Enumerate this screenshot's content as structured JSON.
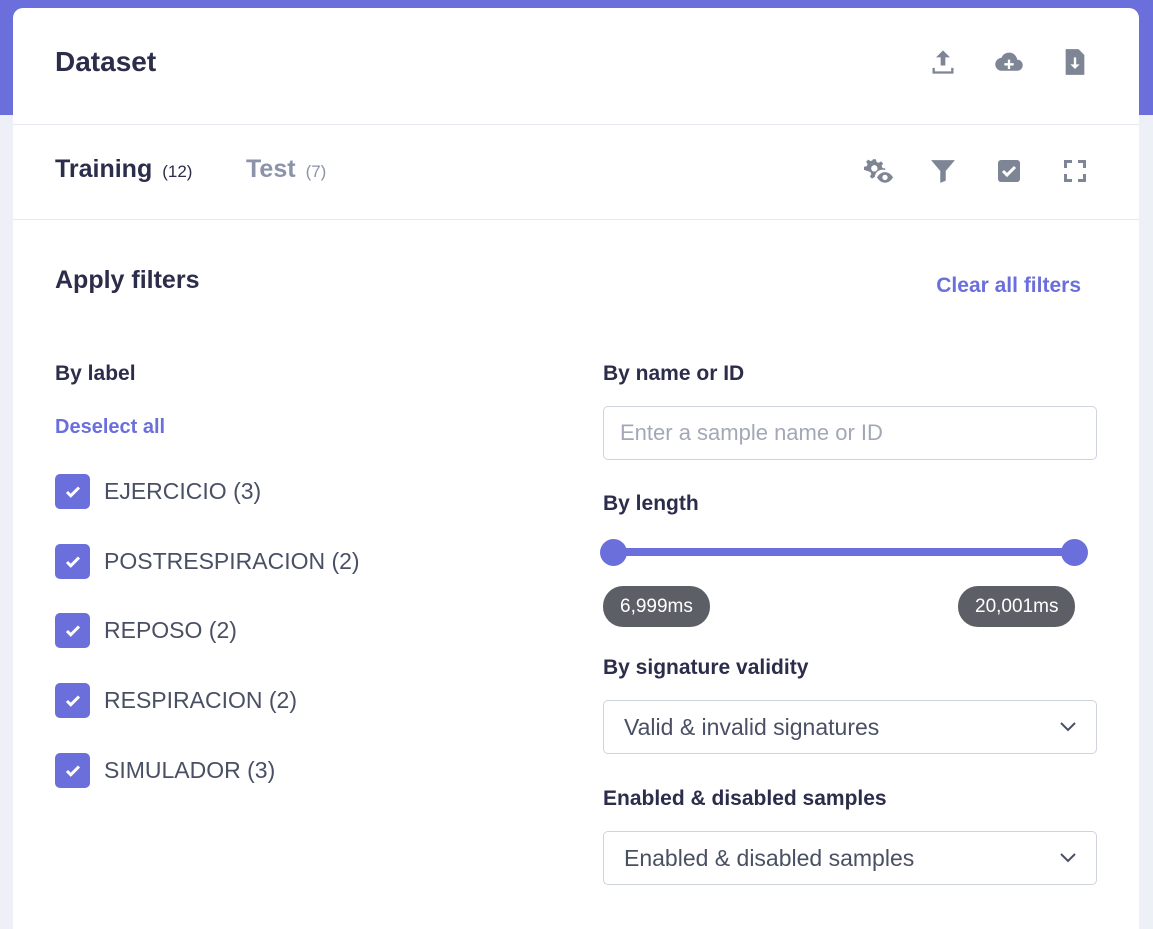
{
  "header": {
    "title": "Dataset",
    "icons": [
      "upload-icon",
      "cloud-add-icon",
      "file-download-icon"
    ]
  },
  "tabs": [
    {
      "label": "Training",
      "count": "(12)",
      "active": true
    },
    {
      "label": "Test",
      "count": "(7)",
      "active": false
    }
  ],
  "tab_toolbar_icons": [
    "settings-eye-icon",
    "filter-icon",
    "check-square-icon",
    "fullscreen-icon"
  ],
  "filters": {
    "title": "Apply filters",
    "clear_label": "Clear all filters",
    "by_label": {
      "title": "By label",
      "deselect_label": "Deselect all",
      "items": [
        {
          "label": "EJERCICIO (3)",
          "checked": true
        },
        {
          "label": "POSTRESPIRACION (2)",
          "checked": true
        },
        {
          "label": "REPOSO (2)",
          "checked": true
        },
        {
          "label": "RESPIRACION (2)",
          "checked": true
        },
        {
          "label": "SIMULADOR (3)",
          "checked": true
        }
      ]
    },
    "by_name": {
      "title": "By name or ID",
      "placeholder": "Enter a sample name or ID",
      "value": ""
    },
    "by_length": {
      "title": "By length",
      "min_label": "6,999ms",
      "max_label": "20,001ms"
    },
    "by_signature": {
      "title": "By signature validity",
      "selected": "Valid & invalid signatures"
    },
    "enabled": {
      "title": "Enabled & disabled samples",
      "selected": "Enabled & disabled samples"
    }
  },
  "colors": {
    "accent": "#6b6fdc",
    "text_dark": "#2b2d4a",
    "icon_gray": "#7e8595"
  }
}
